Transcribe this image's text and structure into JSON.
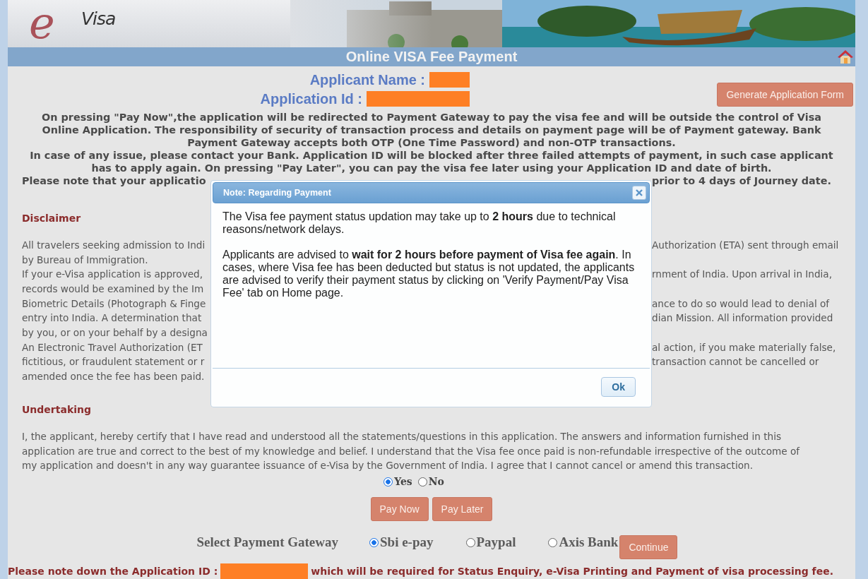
{
  "header": {
    "logo_letter": "e",
    "logo_text": "Visa"
  },
  "title_bar": {
    "title": "Online VISA Fee Payment"
  },
  "applicant": [
    {
      "label": "Applicant Name :"
    },
    {
      "label": "Application Id :"
    }
  ],
  "generate_button": "Generate Application Form",
  "notice": [
    {
      "text": "On pressing \"Pay Now\",the application will be redirected to Payment Gateway to pay the visa fee and will be outside the control of Visa"
    },
    {
      "text": "Online Application. The responsibility of security of transaction process and details on payment page will be of Payment gateway. Bank"
    },
    {
      "text": "Payment Gateway accepts both OTP (One Time Password) and non-OTP transactions."
    },
    {
      "text": "In case of any issue, please contact your Bank. Application ID will be blocked after three failed attempts of payment, in such case applicant"
    },
    {
      "text": "has to apply again. On pressing \"Pay Later\", you can pay the visa fee later using your Application ID and date of birth."
    },
    {
      "left": "Please note that your applicatio",
      "right": "prior to 4 days of Journey date."
    }
  ],
  "disclaimer": {
    "heading": "Disclaimer",
    "lines": [
      {
        "left": "All travelers seeking admission to Indi",
        "right": "Authorization (ETA) sent through email"
      },
      {
        "left": "by Bureau of Immigration."
      },
      {
        "left": "If your e-Visa application is approved,",
        "right": "rnment of India. Upon arrival in India,"
      },
      {
        "left": "records would be examined by the Im"
      },
      {
        "left": "Biometric Details (Photograph & Finge",
        "right": "ance to do so would lead to denial of"
      },
      {
        "left": "entry into India. A determination that",
        "right": "dian Mission. All information provided"
      },
      {
        "left": "by you, or on your behalf by a designa"
      },
      {
        "left": "An Electronic Travel Authorization (ET",
        "right": "al action, if you make materially false,"
      },
      {
        "left": "fictitious, or fraudulent statement or r",
        "right": "transaction cannot be cancelled or"
      },
      {
        "left": "amended once the fee has been paid."
      }
    ]
  },
  "modal": {
    "title": "Note: Regarding Payment",
    "paragraphs": [
      "The Visa fee payment status updation may take up to **2 hours** due to technical reasons/network delays.",
      "Applicants are advised to **wait for 2 hours before payment of Visa fee again**. In cases, where Visa fee has been deducted but status is not updated, the applicants are advised to verify their payment status by clicking on 'Verify Payment/Pay Visa Fee' tab on Home page."
    ],
    "ok": "Ok"
  },
  "undertaking": {
    "heading": "Undertaking",
    "text": "I, the applicant, hereby certify that I have read and understood all the statements/questions in this application. The answers and information furnished in this application are true and correct to the best of my knowledge and belief. I understand that the Visa fee once paid is non-refundable irrespective of the outcome of my application and doesn't in any way guarantee issuance of e-Visa by the Government of India. I agree that I cannot cancel or amend this transaction.",
    "options": [
      {
        "label": "Yes",
        "selected": true
      },
      {
        "label": "No",
        "selected": false
      }
    ]
  },
  "buttons": [
    "Pay Now",
    "Pay Later"
  ],
  "gateway": {
    "label": "Select Payment Gateway",
    "options": [
      {
        "label": "Sbi e-pay",
        "selected": true
      },
      {
        "label": "Paypal",
        "selected": false
      },
      {
        "label": "Axis Bank",
        "selected": false
      }
    ],
    "button": "Continue"
  },
  "footer_note": {
    "before": "Please note down the Application ID :",
    "after": "which will be required for Status Enquiry, e-Visa Printing and Payment of visa processing fee."
  }
}
